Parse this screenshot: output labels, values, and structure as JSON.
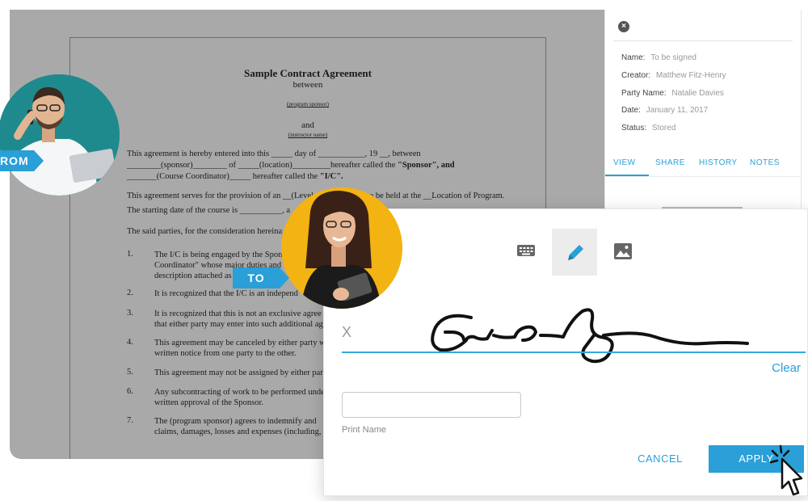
{
  "document": {
    "title": "Sample Contract Agreement",
    "between": "between",
    "program_sponsor": "(program sponsor)",
    "and": "and",
    "instructor_name": "(instructor name)",
    "lines": [
      "This agreement is hereby entered into this _____ day of ___________, 19 __, between",
      "________(sponsor)________ of _____(location)_________hereafter called the",
      "\"Sponsor\", and",
      "_______(Course Coordinator)_____ hereafter called the",
      "\"I/C\".",
      "This agreement serves for the provision of an __(Level of ...) program to be held at the __Location of Program.",
      "The starting date of the course is __________, a",
      "The said parties, for the consideration hereina"
    ],
    "items": [
      {
        "num": "1.",
        "text": [
          "The I/C is being engaged by the Spon",
          "Coordinator\" whose major duties and",
          "description attached as"
        ]
      },
      {
        "num": "2.",
        "text": [
          "It is recognized that the I/C is an independ"
        ]
      },
      {
        "num": "3.",
        "text": [
          "It is recognized that this is not an exclusive agree",
          "that either party may enter into such additional ag"
        ]
      },
      {
        "num": "4.",
        "text": [
          "This agreement may be canceled by either party w",
          "written notice from one party to the other."
        ]
      },
      {
        "num": "5.",
        "text": [
          "This agreement may not be assigned by either par"
        ]
      },
      {
        "num": "6.",
        "text": [
          "Any subcontracting of work to be performed unde",
          "written approval of the Sponsor."
        ]
      },
      {
        "num": "7.",
        "text": [
          "The (program sponsor) agrees to indemnify and",
          "claims, damages, losses and expenses (including,"
        ]
      }
    ]
  },
  "panel": {
    "fields": [
      {
        "label": "Name:",
        "value": "To be signed"
      },
      {
        "label": "Creator:",
        "value": "Matthew Fitz-Henry"
      },
      {
        "label": "Party Name:",
        "value": "Natalie Davies"
      },
      {
        "label": "Date:",
        "value": "January 11, 2017"
      },
      {
        "label": "Status:",
        "value": "Stored"
      }
    ],
    "tabs": [
      "VIEW",
      "SHARE",
      "HISTORY",
      "NOTES"
    ]
  },
  "signature": {
    "x_mark": "X",
    "clear": "Clear",
    "print_name_label": "Print Name",
    "print_name_value": "",
    "cancel": "CANCEL",
    "apply": "APPLY",
    "modes": [
      "keyboard-icon",
      "pen-icon",
      "image-icon"
    ]
  },
  "tags": {
    "from": "ROM",
    "to": "TO"
  },
  "colors": {
    "accent": "#2a9fd8",
    "viewer_bg": "#a9a9a9",
    "from_avatar_bg": "#1f8a8d",
    "to_avatar_bg": "#f2b313"
  }
}
